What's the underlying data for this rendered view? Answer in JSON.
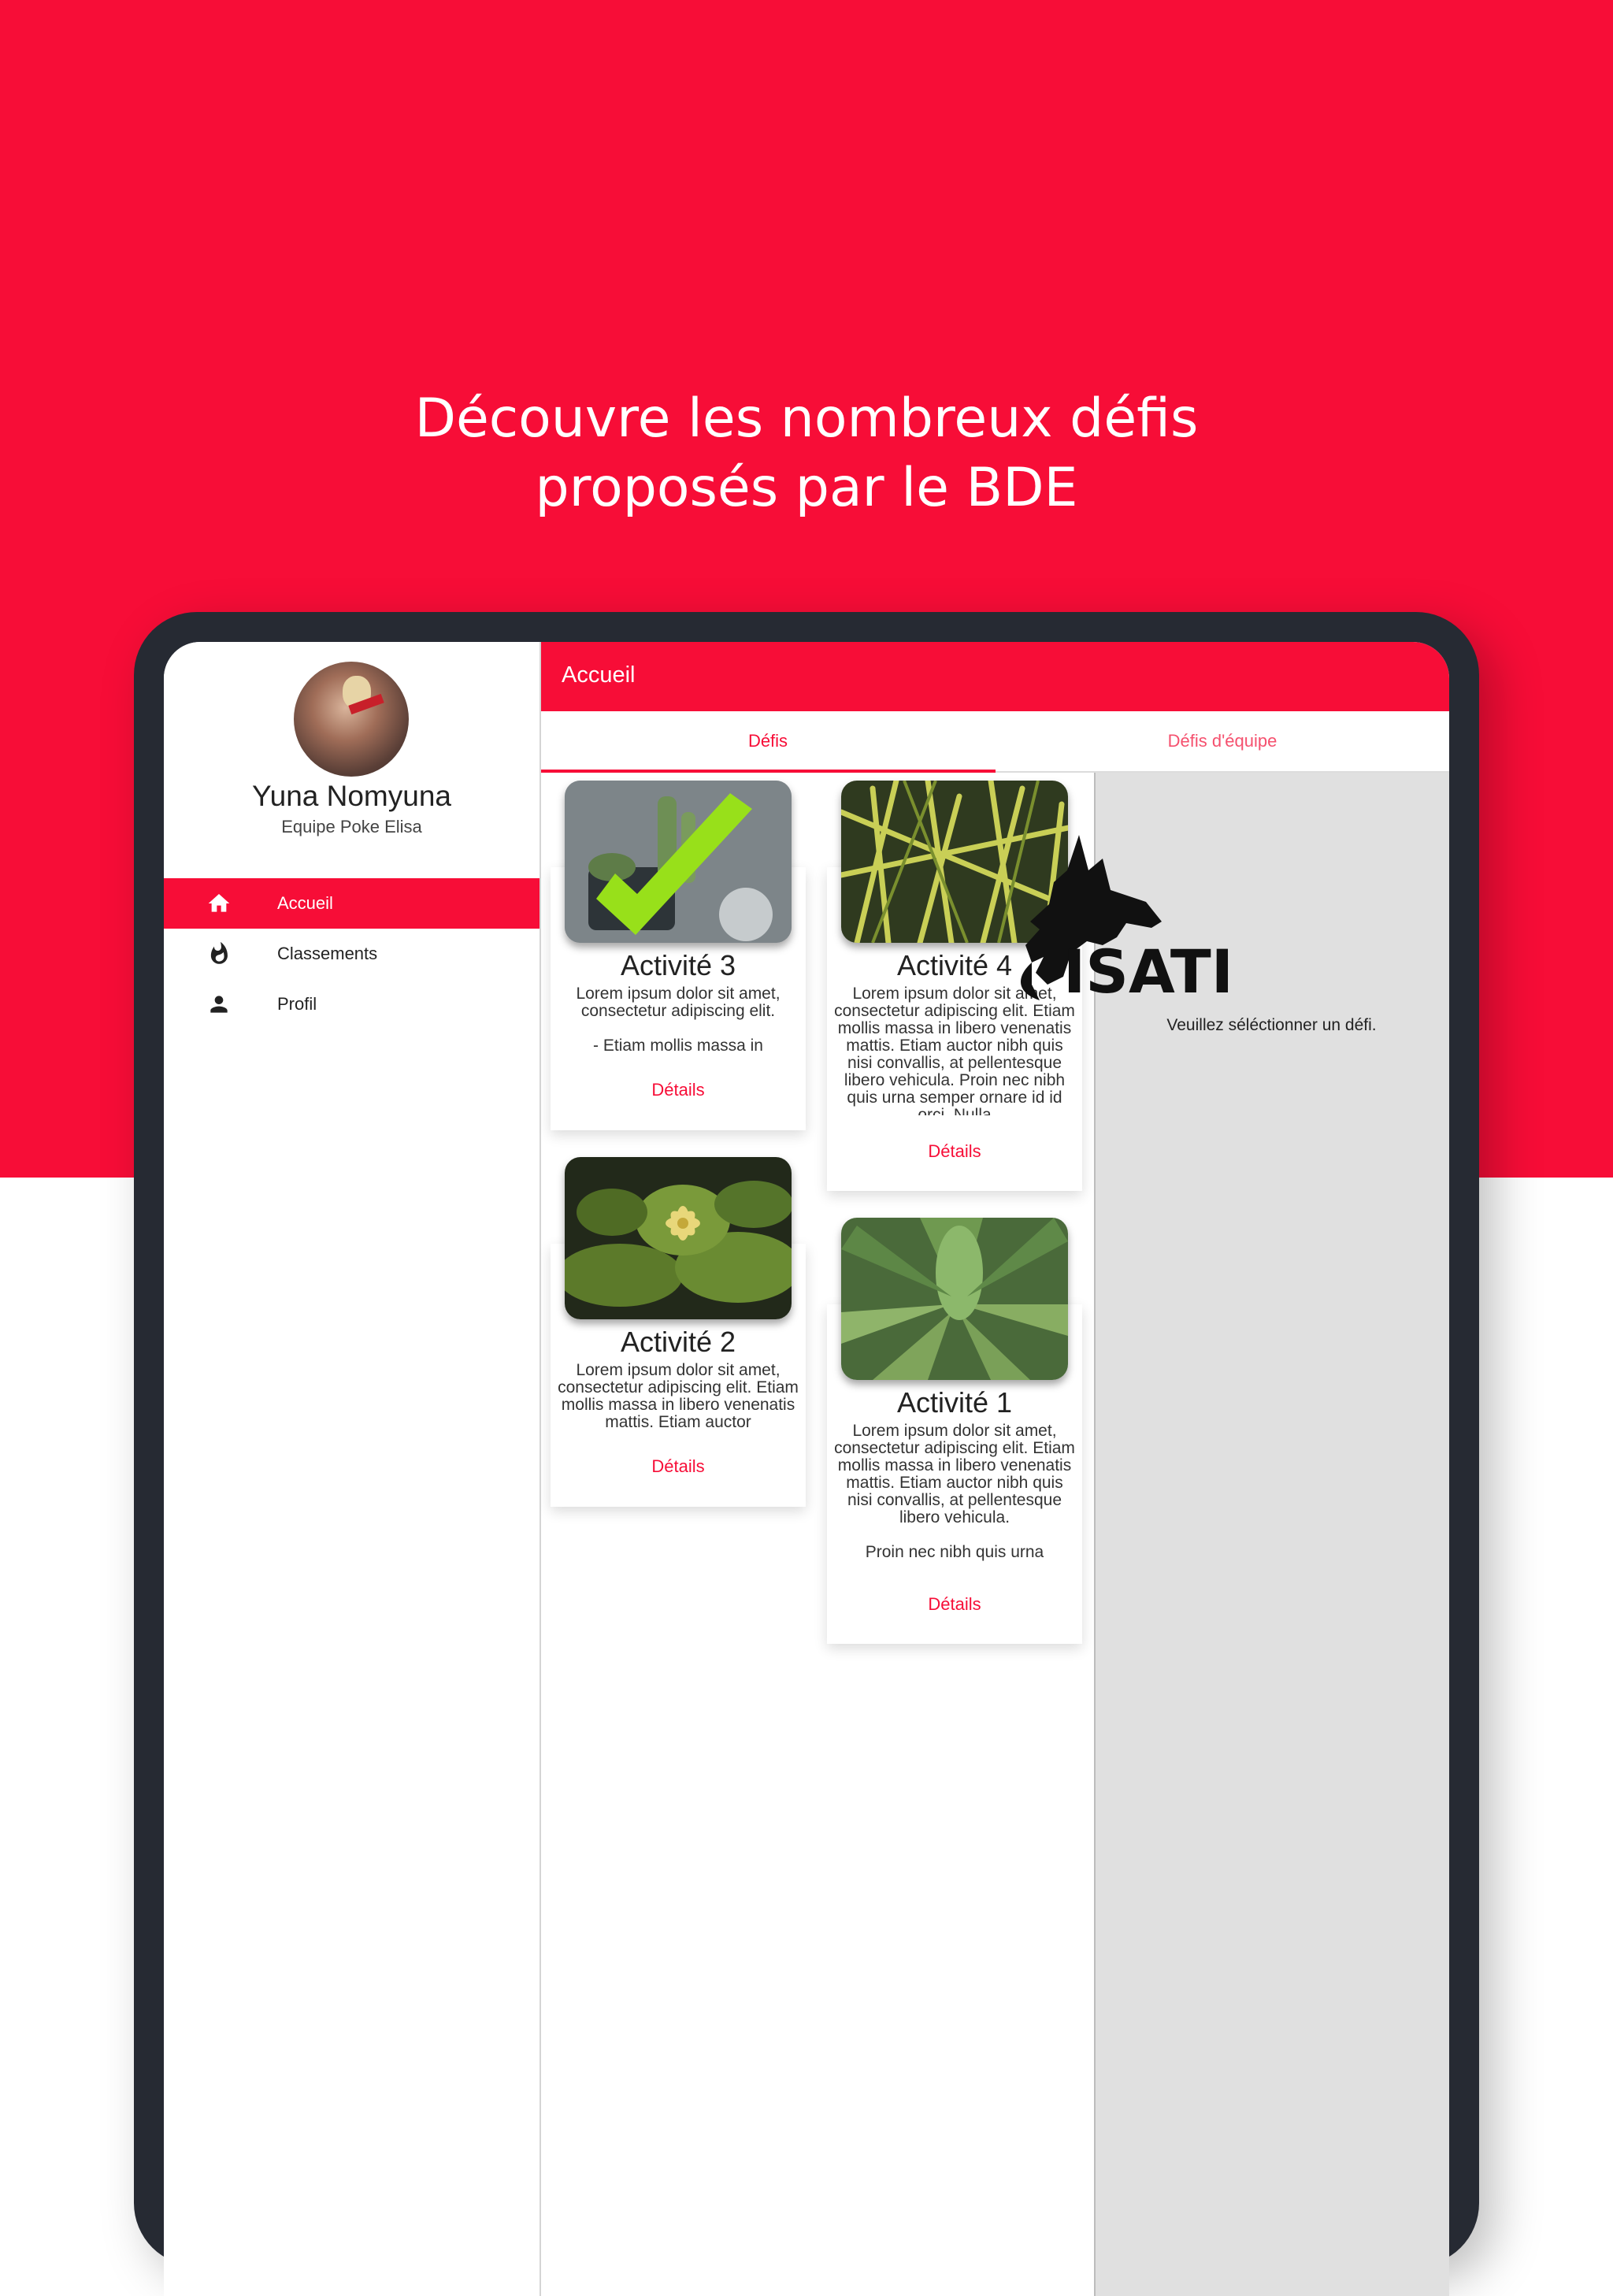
{
  "headline": {
    "line1": "Découvre les nombreux défis",
    "line2": "proposés par le BDE"
  },
  "sidebar": {
    "user_name": "Yuna Nomyuna",
    "team": "Equipe Poke Elisa",
    "items": [
      {
        "label": "Accueil",
        "icon": "home-icon",
        "active": true
      },
      {
        "label": "Classements",
        "icon": "fire-icon",
        "active": false
      },
      {
        "label": "Profil",
        "icon": "person-icon",
        "active": false
      }
    ]
  },
  "appbar": {
    "title": "Accueil"
  },
  "tabs": [
    {
      "label": "Défis",
      "selected": true
    },
    {
      "label": "Défis d'équipe",
      "selected": false
    }
  ],
  "cards": [
    {
      "title": "Activité 3",
      "text": "Lorem ipsum dolor sit amet, consectetur adipiscing elit.\n\n- Etiam mollis massa in",
      "link": "Détails",
      "completed": true
    },
    {
      "title": "Activité 4",
      "text": "Lorem ipsum dolor sit amet, consectetur adipiscing elit. Etiam mollis massa in libero venenatis mattis. Etiam auctor nibh quis nisi convallis, at pellentesque libero vehicula. Proin nec nibh quis urna semper ornare id id orci. Nulla",
      "link": "Détails",
      "completed": false
    },
    {
      "title": "Activité 2",
      "text": "Lorem ipsum dolor sit amet, consectetur adipiscing elit. Etiam mollis massa in libero venenatis mattis. Etiam auctor",
      "link": "Détails",
      "completed": false
    },
    {
      "title": "Activité 1",
      "text": "Lorem ipsum dolor sit amet, consectetur adipiscing elit. Etiam mollis massa in libero venenatis mattis. Etiam auctor nibh quis nisi convallis, at pellentesque libero vehicula.\n\nProin nec nibh quis urna",
      "link": "Détails",
      "completed": false
    }
  ],
  "detail": {
    "logo_text": "ISATI",
    "hint": "Veuillez séléctionner un défi."
  },
  "colors": {
    "brand": "#f70d37",
    "device": "#262a33",
    "pane": "#e0e0e0",
    "check": "#98e01a"
  }
}
